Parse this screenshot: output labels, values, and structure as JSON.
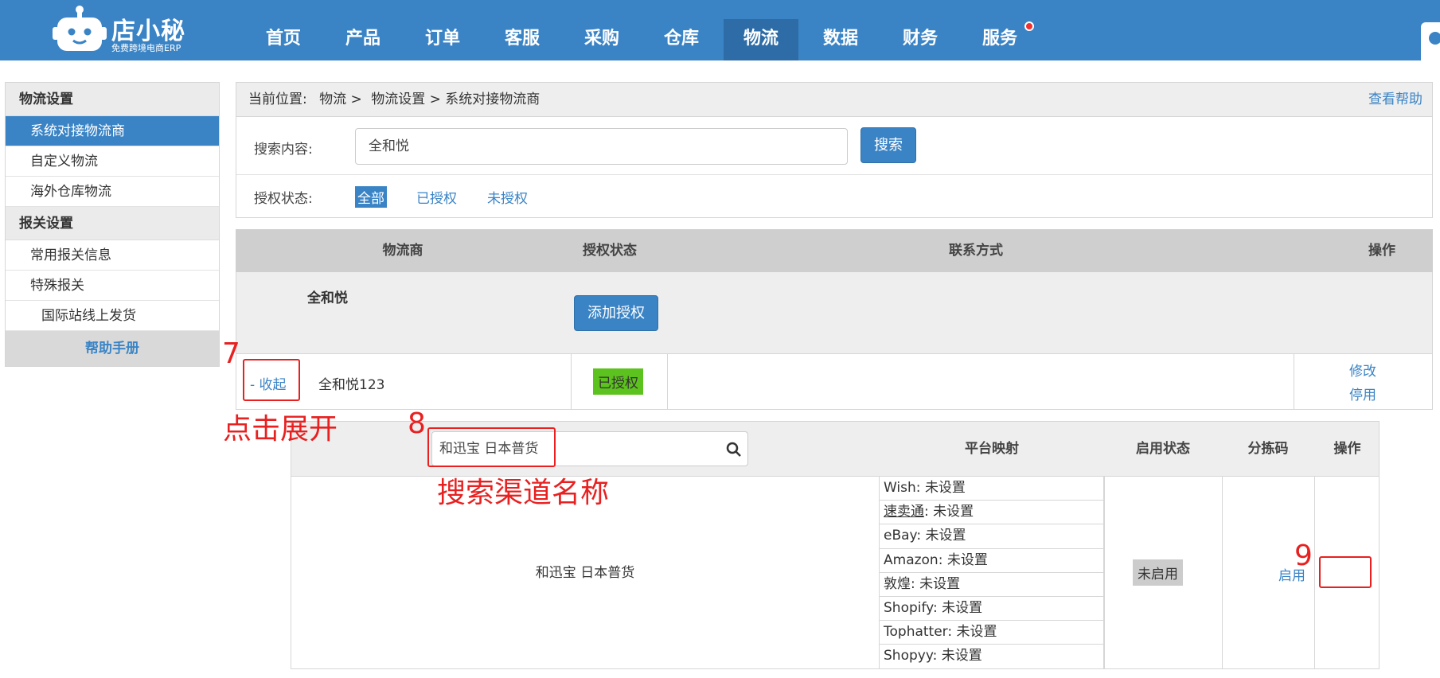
{
  "app": {
    "logo_name": "店小秘",
    "logo_sub": "免费跨境电商ERP"
  },
  "nav": {
    "items": [
      "首页",
      "产品",
      "订单",
      "客服",
      "采购",
      "仓库",
      "物流",
      "数据",
      "财务",
      "服务"
    ],
    "active": "物流"
  },
  "sidebar": {
    "section1": "物流设置",
    "items1": [
      "系统对接物流商",
      "自定义物流",
      "海外仓库物流"
    ],
    "section2": "报关设置",
    "items2": [
      "常用报关信息",
      "特殊报关",
      "国际站线上发货"
    ],
    "help": "帮助手册"
  },
  "breadcrumb": {
    "prefix": "当前位置:",
    "path1": "物流",
    "path2": "物流设置",
    "path3": "系统对接物流商",
    "sep": ">",
    "help_link": "查看帮助"
  },
  "filter": {
    "search_label": "搜索内容:",
    "search_value": "全和悦",
    "search_button": "搜索",
    "auth_label": "授权状态:",
    "tab_all": "全部",
    "tab_authorized": "已授权",
    "tab_unauthorized": "未授权"
  },
  "table": {
    "headers": [
      "物流商",
      "授权状态",
      "联系方式",
      "操作"
    ],
    "group_name": "全和悦",
    "add_auth_button": "添加授权",
    "row": {
      "collapse": "- 收起",
      "carrier": "全和悦123",
      "status": "已授权",
      "op_edit": "修改",
      "op_disable": "停用"
    }
  },
  "sub_table": {
    "channel_search_value": "和迅宝 日本普货",
    "headers": [
      "平台映射",
      "启用状态",
      "分拣码",
      "操作"
    ],
    "channel_name": "和迅宝 日本普货",
    "mappings": [
      {
        "platform": "Wish",
        "value": "未设置"
      },
      {
        "platform": "速卖通",
        "value": "未设置"
      },
      {
        "platform": "eBay",
        "value": "未设置"
      },
      {
        "platform": "Amazon",
        "value": "未设置"
      },
      {
        "platform": "敦煌",
        "value": "未设置"
      },
      {
        "platform": "Shopify",
        "value": "未设置"
      },
      {
        "platform": "Tophatter",
        "value": "未设置"
      },
      {
        "platform": "Shopyy",
        "value": "未设置"
      }
    ],
    "status": "未启用",
    "enable_link": "启用"
  },
  "annotations": {
    "n7": "7",
    "n8": "8",
    "n9": "9",
    "text7": "点击展开",
    "text8": "搜索渠道名称"
  }
}
